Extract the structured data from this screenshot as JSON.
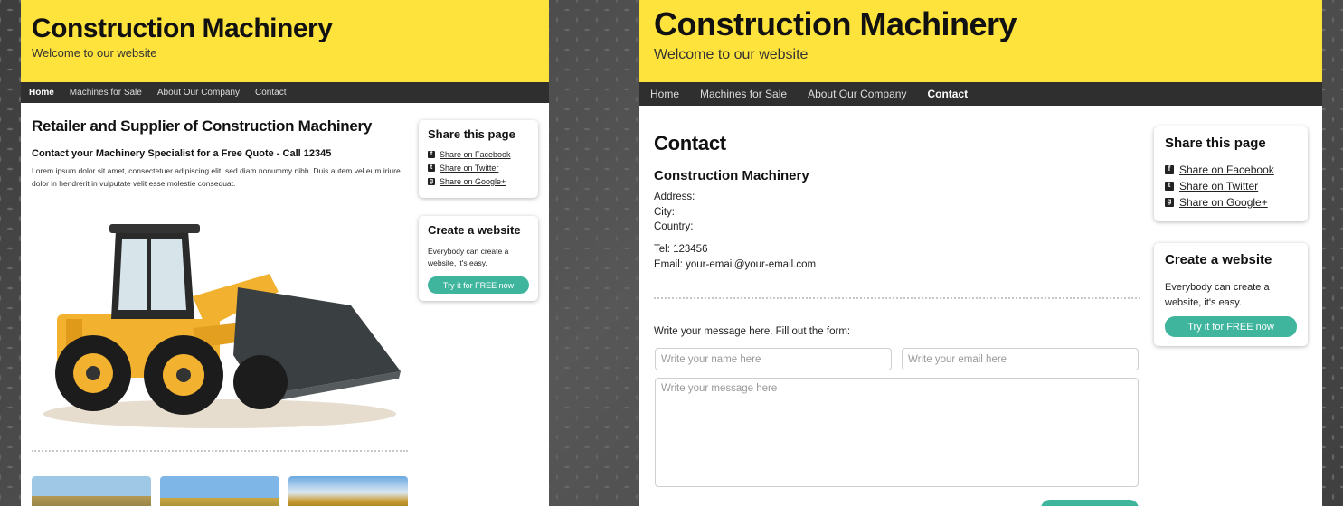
{
  "site": {
    "title": "Construction Machinery",
    "subtitle": "Welcome to our website"
  },
  "nav": {
    "home": "Home",
    "machines": "Machines for Sale",
    "about": "About Our Company",
    "contact": "Contact"
  },
  "home_page": {
    "heading": "Retailer and Supplier of Construction Machinery",
    "subheading": "Contact your Machinery Specialist for a Free Quote - Call 12345",
    "body": "Lorem ipsum dolor sit amet, consectetuer adipiscing elit, sed diam nonummy nibh. Duis autem vel eum iriure dolor in hendrerit in vulputate velit esse molestie consequat."
  },
  "contact_page": {
    "heading": "Contact",
    "company": "Construction Machinery",
    "address_label": "Address:",
    "city_label": "City:",
    "country_label": "Country:",
    "tel": "Tel: 123456",
    "email": "Email: your-email@your-email.com",
    "form_prompt": "Write your message here. Fill out the form:",
    "name_placeholder": "Write your name here",
    "email_placeholder": "Write your email here",
    "message_placeholder": "Write your message here"
  },
  "sidebar": {
    "share_title": "Share this page",
    "share_facebook": "Share on Facebook",
    "share_twitter": "Share on Twitter",
    "share_google": "Share on Google+",
    "create_title": "Create a website",
    "create_text": "Everybody can create a website, it's easy.",
    "create_cta": "Try it for FREE now"
  },
  "colors": {
    "header_yellow": "#ffe33d",
    "nav_dark": "#2f2f2f",
    "accent_teal": "#3fb59d"
  }
}
